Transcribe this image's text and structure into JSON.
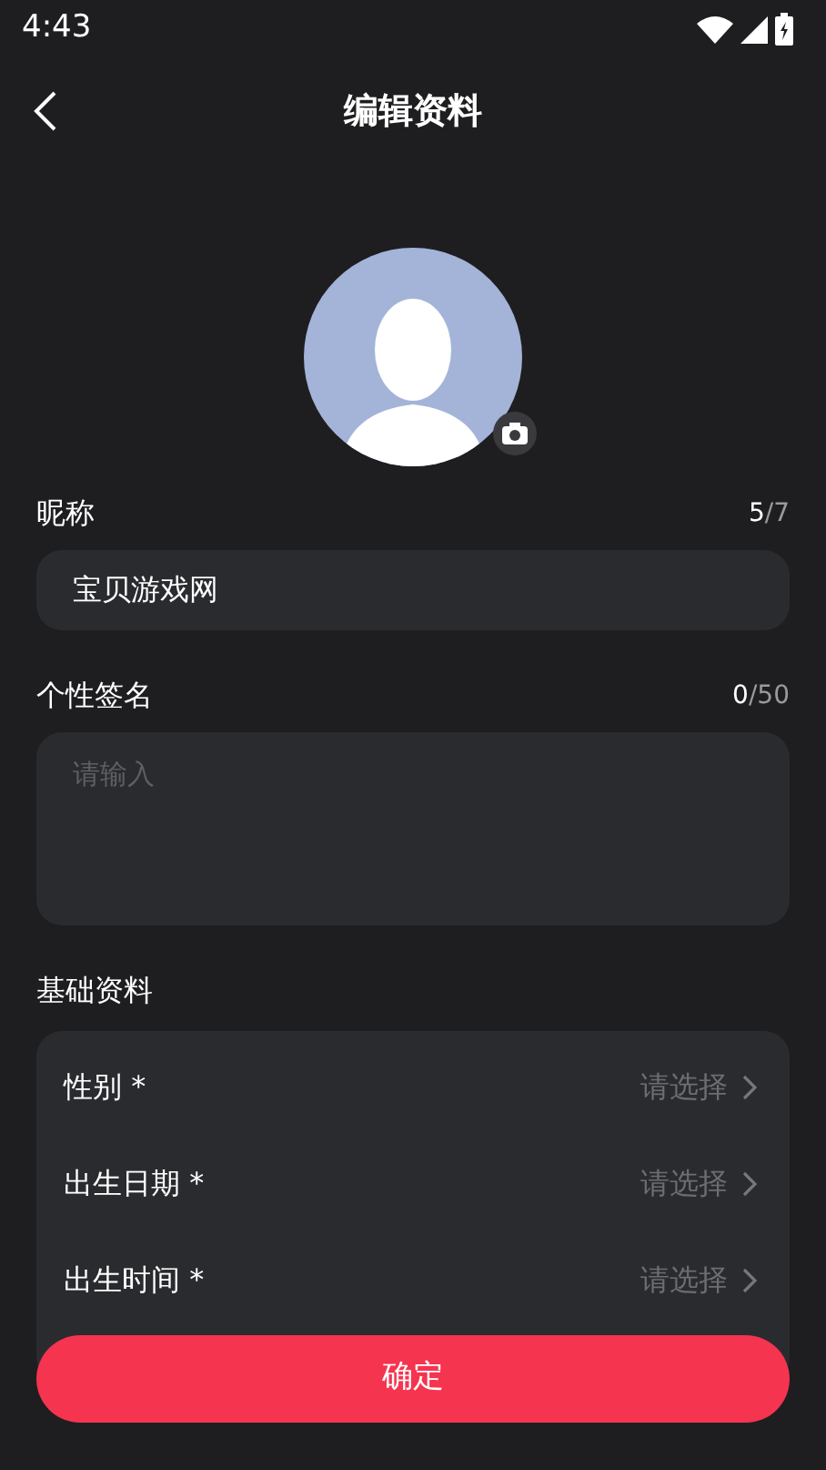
{
  "status_bar": {
    "time": "4:43"
  },
  "header": {
    "title": "编辑资料"
  },
  "nickname": {
    "label": "昵称",
    "count": "5",
    "limit": "/7",
    "value": "宝贝游戏网"
  },
  "signature": {
    "label": "个性签名",
    "count": "0",
    "limit": "/50",
    "placeholder": "请输入"
  },
  "basic": {
    "label": "基础资料",
    "rows": [
      {
        "label": "性别 *",
        "placeholder": "请选择"
      },
      {
        "label": "出生日期 *",
        "placeholder": "请选择"
      },
      {
        "label": "出生时间 *",
        "placeholder": "请选择"
      }
    ]
  },
  "confirm_button": "确定"
}
